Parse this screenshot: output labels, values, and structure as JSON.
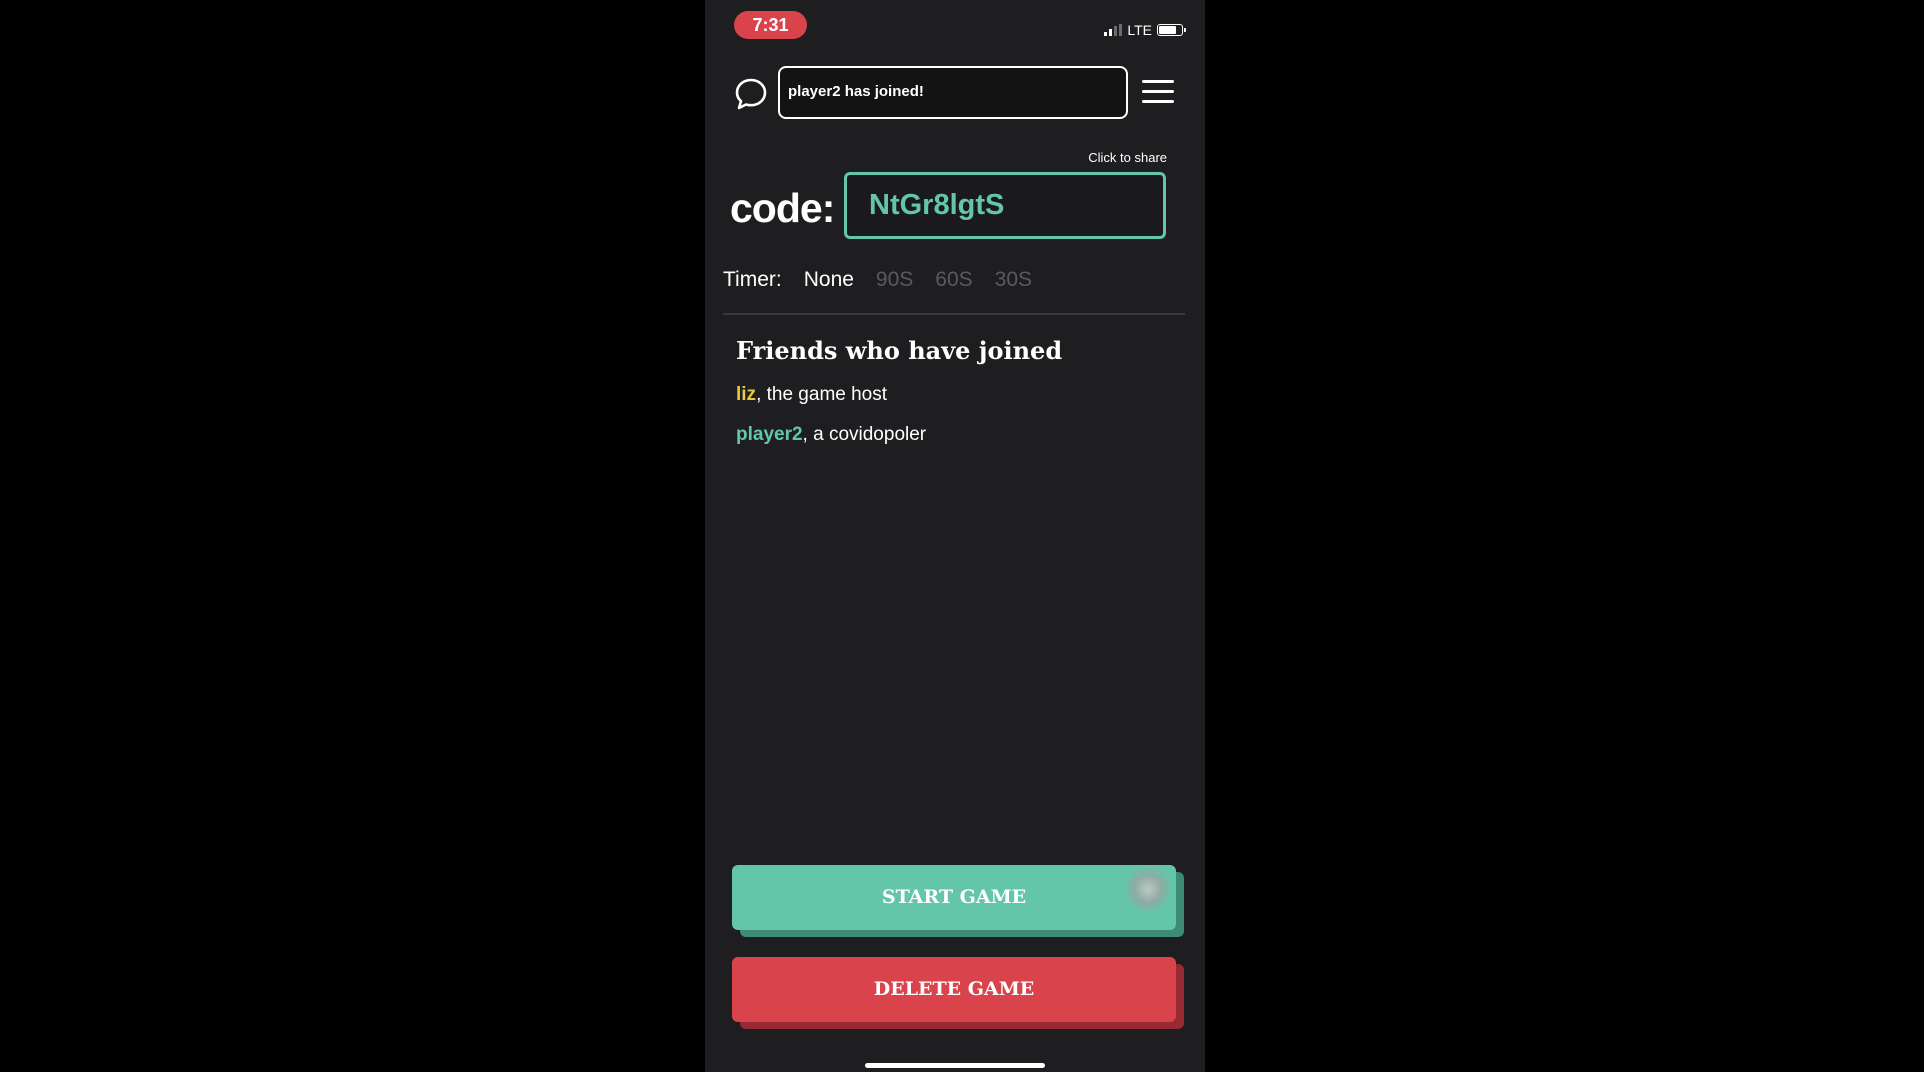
{
  "status_bar": {
    "time": "7:31",
    "network": "LTE"
  },
  "header": {
    "notification": "player2 has joined!"
  },
  "code": {
    "share_hint": "Click to share",
    "label": "code:",
    "value": "NtGr8lgtS"
  },
  "timer": {
    "label": "Timer:",
    "options": [
      "None",
      "90S",
      "60S",
      "30S"
    ],
    "selected": "None"
  },
  "friends": {
    "title": "Friends who have joined",
    "list": [
      {
        "name": "liz",
        "role": ", the game host",
        "color": "#e7c842"
      },
      {
        "name": "player2",
        "role": ", a covidopoler",
        "color": "#63c6a8"
      }
    ]
  },
  "buttons": {
    "start": "START GAME",
    "delete": "DELETE GAME"
  },
  "colors": {
    "accent_green": "#63c6a8",
    "accent_red": "#d9434b",
    "host_yellow": "#e7c842",
    "background": "#1e1e20"
  }
}
